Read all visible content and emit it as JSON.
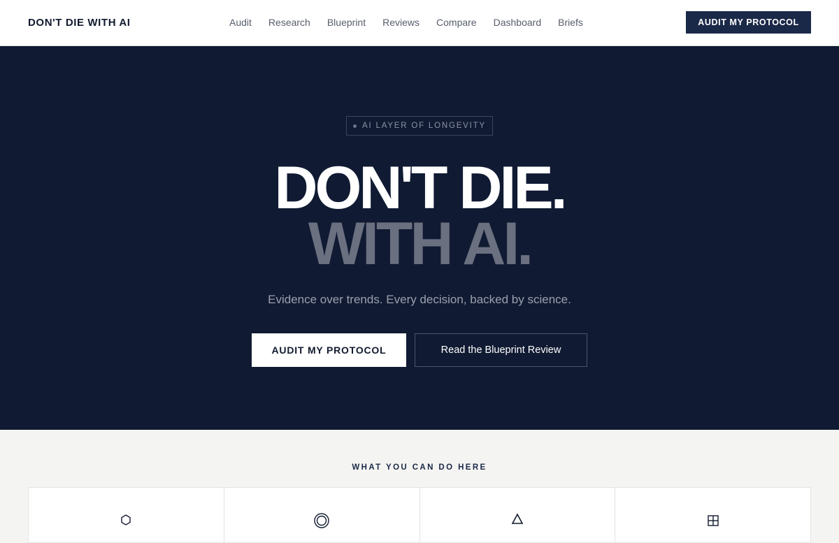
{
  "nav": {
    "logo": "DON'T DIE WITH AI",
    "links": [
      "Audit",
      "Research",
      "Blueprint",
      "Reviews",
      "Compare",
      "Dashboard",
      "Briefs"
    ],
    "cta": "AUDIT MY PROTOCOL"
  },
  "hero": {
    "badge": "AI LAYER OF LONGEVITY",
    "headline_line1": "DON'T DIE.",
    "headline_line2": "WITH AI.",
    "subtitle": "Evidence over trends. Every decision, backed by science.",
    "primary_button": "AUDIT MY PROTOCOL",
    "secondary_button": "Read the Blueprint Review"
  },
  "features": {
    "title": "WHAT YOU CAN DO HERE",
    "cards": [
      {
        "icon": "hexagon-icon"
      },
      {
        "icon": "double-circle-icon"
      },
      {
        "icon": "triangle-icon"
      },
      {
        "icon": "grid-square-icon"
      }
    ]
  },
  "colors": {
    "hero_bg": "#101a32",
    "accent": "#1b2948",
    "muted_headline": "#6b7080"
  }
}
